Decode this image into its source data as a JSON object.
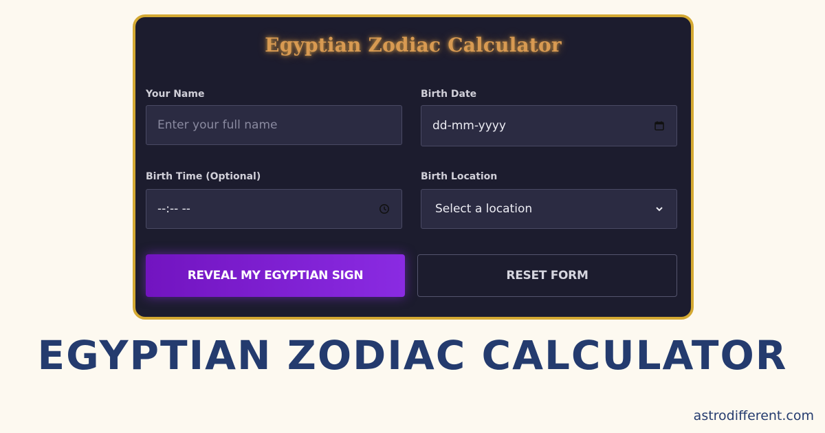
{
  "card": {
    "title": "Egyptian Zodiac Calculator"
  },
  "form": {
    "name": {
      "label": "Your Name",
      "placeholder": "Enter your full name"
    },
    "birth_date": {
      "label": "Birth Date",
      "value": "dd-mm-yyyy",
      "icon": "calendar-icon"
    },
    "birth_time": {
      "label": "Birth Time (Optional)",
      "value": "--:-- --",
      "icon": "clock-icon"
    },
    "birth_location": {
      "label": "Birth Location",
      "selected": "Select a location",
      "icon": "chevron-down-icon"
    }
  },
  "buttons": {
    "reveal_label": "REVEAL MY EGYPTIAN SIGN",
    "reset_label": "RESET FORM"
  },
  "headline": "EGYPTIAN ZODIAC CALCULATOR",
  "site": "astrodifferent.com",
  "colors": {
    "page_bg": "#fdf9f0",
    "card_bg": "#1c1c2e",
    "card_border": "#d4a933",
    "title_gold": "#d89a52",
    "field_bg": "#2b2b42",
    "primary_button": "#8a2be2",
    "headline_navy": "#243b6e"
  }
}
